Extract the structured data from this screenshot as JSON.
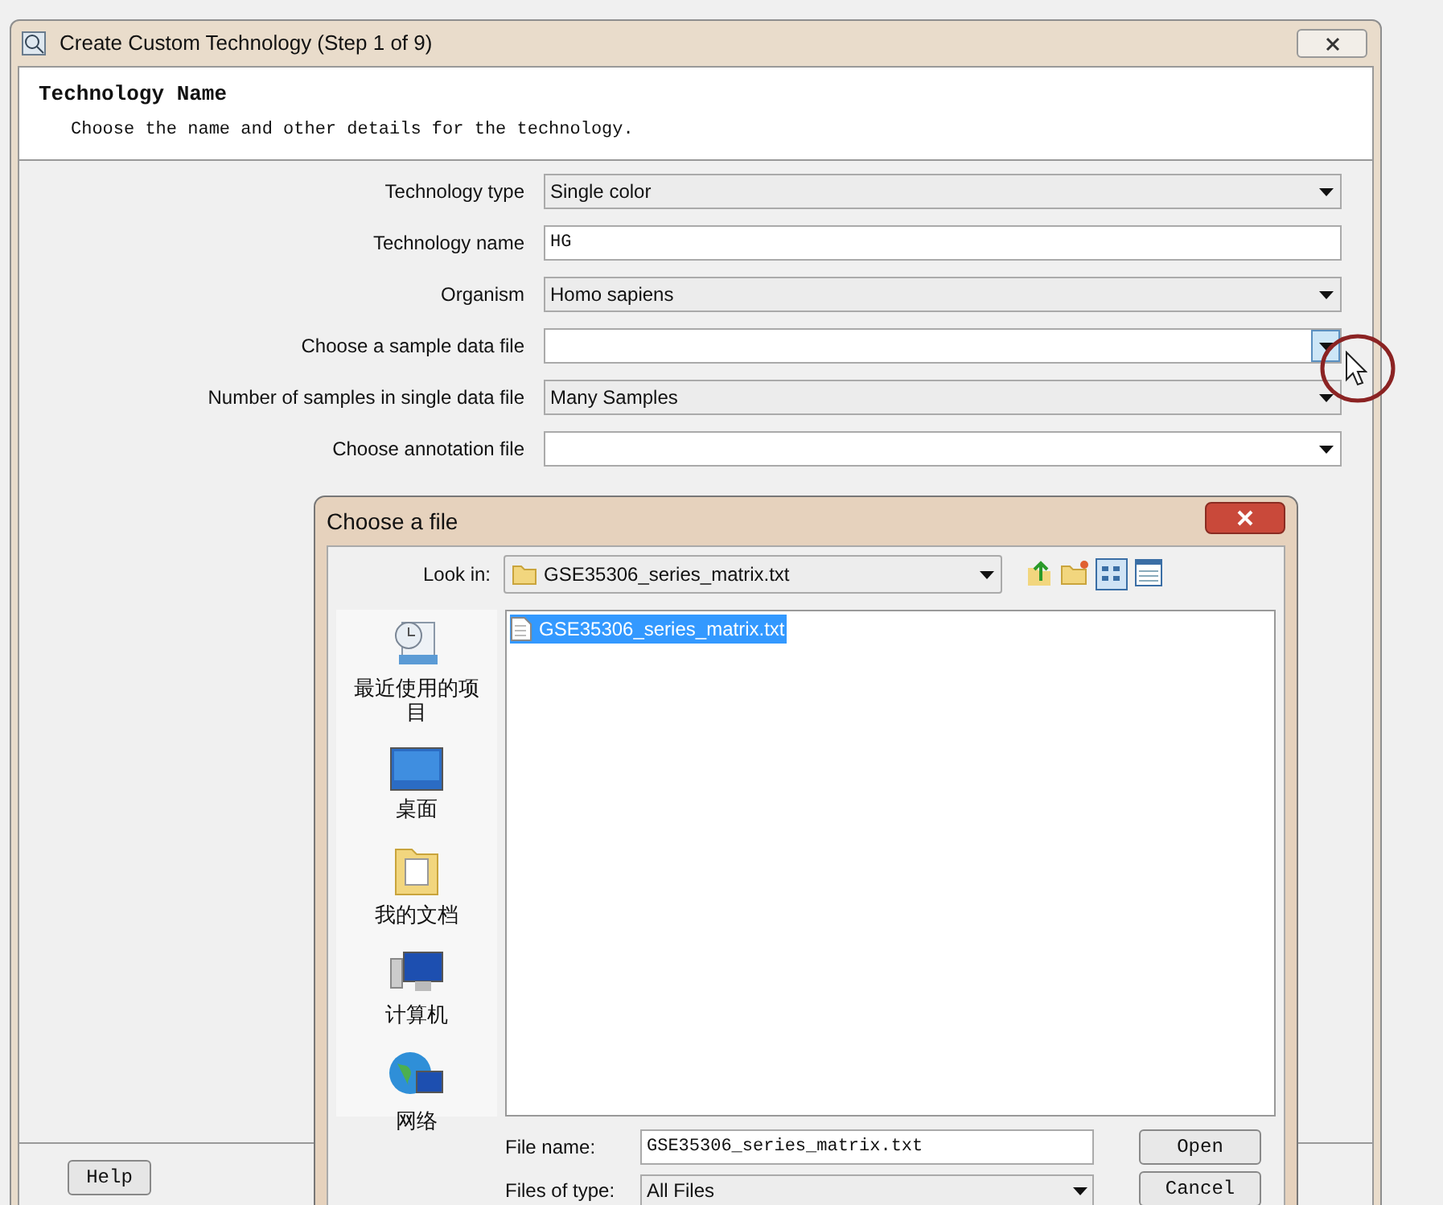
{
  "window": {
    "title": "Create Custom Technology (Step 1 of 9)"
  },
  "header": {
    "title": "Technology Name",
    "subtitle": "Choose the name and other details for the technology."
  },
  "fields": [
    {
      "label": "Technology type",
      "kind": "dropdown",
      "value": "Single color",
      "pressed": false
    },
    {
      "label": "Technology name",
      "kind": "text",
      "value": "HG"
    },
    {
      "label": "Organism",
      "kind": "dropdown",
      "value": "Homo sapiens",
      "pressed": false
    },
    {
      "label": "Choose a sample data file",
      "kind": "dropdown",
      "pressed": true
    },
    {
      "label": "Number of samples in single data file",
      "kind": "dropdown",
      "value": "Many Samples",
      "pressed": false
    },
    {
      "label": "Choose annotation file",
      "kind": "dropdown",
      "pressed": false
    }
  ],
  "help_button": "Help",
  "file_dialog": {
    "title": "Choose a file",
    "look_in_label": "Look in:",
    "look_in_value": "GSE35306_series_matrix.txt",
    "places": [
      {
        "label": "最近使用的项目",
        "kind": "recent"
      },
      {
        "label": "桌面",
        "kind": "desktop"
      },
      {
        "label": "我的文档",
        "kind": "documents"
      },
      {
        "label": "计算机",
        "kind": "computer"
      },
      {
        "label": "网络",
        "kind": "network"
      }
    ],
    "files": [
      {
        "name": "GSE35306_series_matrix.txt",
        "selected": true
      }
    ],
    "file_name_label": "File name:",
    "file_name_value": "GSE35306_series_matrix.txt",
    "file_type_label": "Files of type:",
    "file_type_value": "All Files",
    "buttons": [
      "Open",
      "Cancel"
    ]
  }
}
